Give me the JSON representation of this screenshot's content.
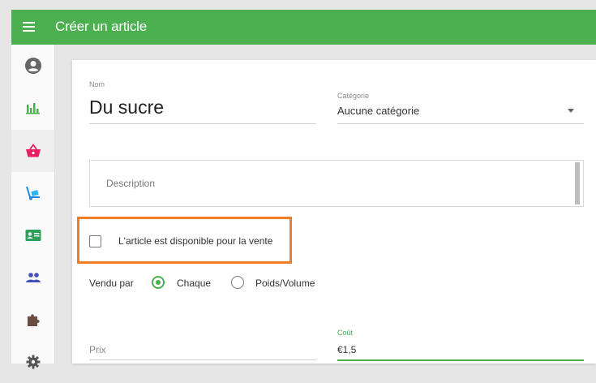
{
  "header": {
    "title": "Créer un article",
    "menu_icon": "hamburger-menu-icon"
  },
  "sidebar": {
    "items": [
      {
        "icon": "account-icon",
        "active": false
      },
      {
        "icon": "bar-chart-icon",
        "active": false
      },
      {
        "icon": "basket-icon",
        "active": true
      },
      {
        "icon": "hand-truck-icon",
        "active": false
      },
      {
        "icon": "id-card-icon",
        "active": false
      },
      {
        "icon": "people-icon",
        "active": false
      },
      {
        "icon": "puzzle-icon",
        "active": false
      },
      {
        "icon": "gear-icon",
        "active": false
      }
    ]
  },
  "form": {
    "name_label": "Nom",
    "name_value": "Du sucre",
    "category_label": "Catégorie",
    "category_value": "Aucune catégorie",
    "description_placeholder": "Description",
    "available_label": "L'article est disponible pour la vente",
    "available_checked": false,
    "sold_by_label": "Vendu par",
    "sold_by_options": [
      {
        "label": "Chaque",
        "selected": true
      },
      {
        "label": "Poids/Volume",
        "selected": false
      }
    ],
    "price_placeholder": "Prix",
    "cost_label": "Coût",
    "cost_value": "€1,5"
  },
  "colors": {
    "primary": "#4caf50",
    "highlight": "#f07c23",
    "active_icon": "#e91e63"
  }
}
